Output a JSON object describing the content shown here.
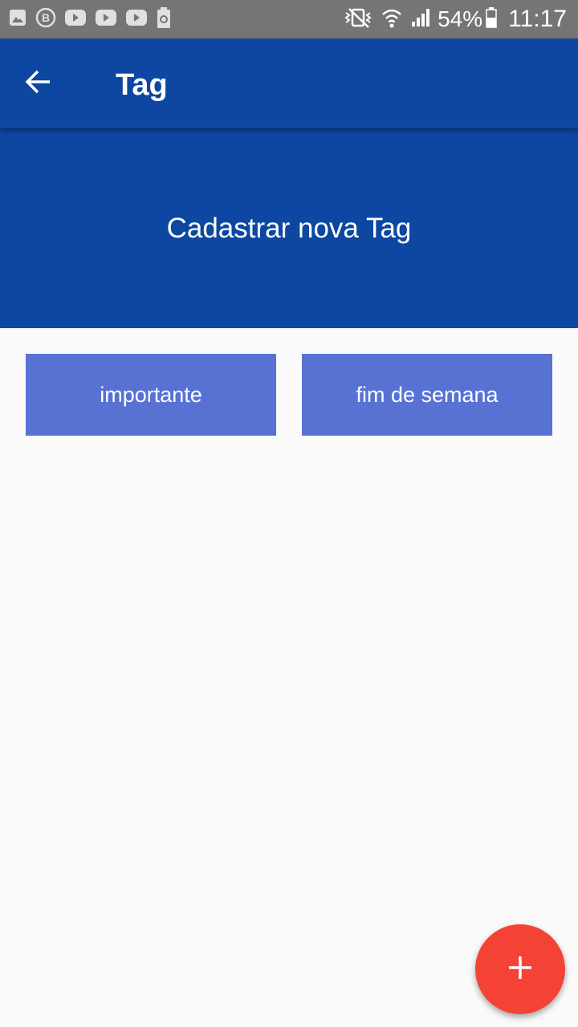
{
  "status_bar": {
    "left_icons": [
      "gallery-icon",
      "b-badge-icon",
      "youtube-icon",
      "youtube-icon",
      "youtube-icon",
      "battery-saver-icon"
    ],
    "battery_percent": "54%",
    "time": "11:17"
  },
  "app_bar": {
    "title": "Tag",
    "back_icon": "arrow-back-icon"
  },
  "banner": {
    "label": "Cadastrar nova Tag"
  },
  "tags": [
    {
      "label": "importante"
    },
    {
      "label": "fim de semana"
    }
  ],
  "fab": {
    "icon": "plus-icon"
  },
  "colors": {
    "status_bar": "#757575",
    "primary": "#0d47a1",
    "tag": "#5872d3",
    "fab": "#f44336",
    "background": "#fafafa"
  }
}
